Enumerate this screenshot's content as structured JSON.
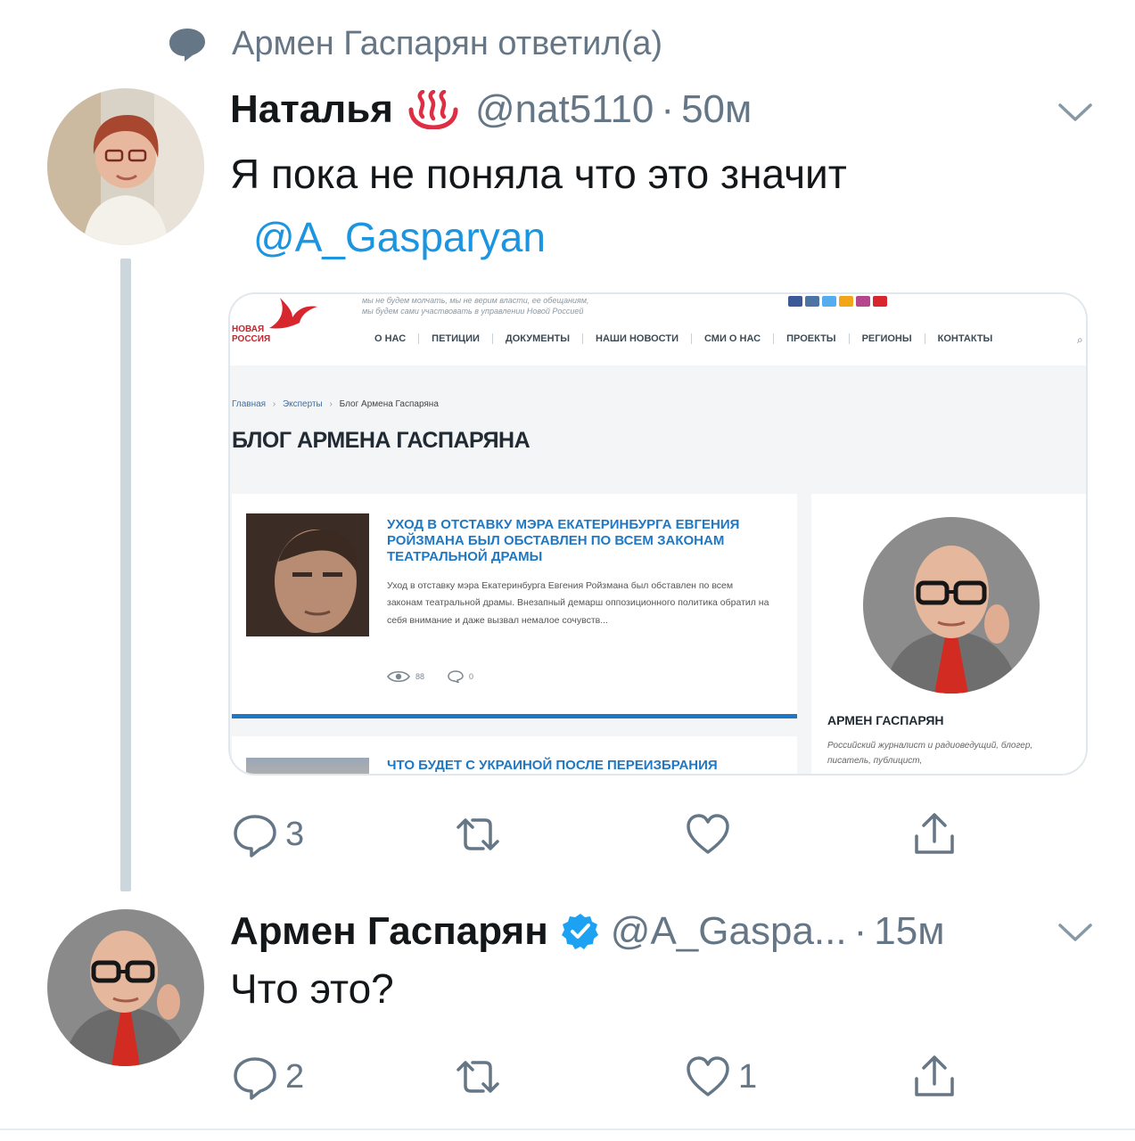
{
  "context": {
    "text": "Армен Гаспарян ответил(а)",
    "icon": "speech-bubble-icon"
  },
  "tweet1": {
    "name": "Наталья",
    "emoji": "hot-springs-emoji",
    "handle": "@nat5110",
    "separator": "·",
    "time": "50м",
    "text": "Я пока не поняла что это значит",
    "mention": "@A_Gasparyan",
    "card": {
      "slogan_line1": "мы не будем молчать, мы не верим власти, ее обещаниям,",
      "slogan_line2": "мы будем сами участвовать в управлении Новой Россией",
      "logo_line1": "НОВАЯ",
      "logo_line2": "РОССИЯ",
      "nav": [
        "О НАС",
        "ПЕТИЦИИ",
        "ДОКУМЕНТЫ",
        "НАШИ НОВОСТИ",
        "СМИ О НАС",
        "ПРОЕКТЫ",
        "РЕГИОНЫ",
        "КОНТАКТЫ"
      ],
      "breadcrumb": {
        "home": "Главная",
        "experts": "Эксперты",
        "current": "Блог Армена Гаспаряна",
        "sep": "›"
      },
      "heading": "БЛОГ АРМЕНА ГАСПАРЯНА",
      "article": {
        "title": "УХОД В ОТСТАВКУ МЭРА ЕКАТЕРИНБУРГА ЕВГЕНИЯ РОЙЗМАНА БЫЛ ОБСТАВЛЕН ПО ВСЕМ ЗАКОНАМ ТЕАТРАЛЬНОЙ ДРАМЫ",
        "excerpt": "Уход в отставку мэра Екатеринбурга Евгения Ройзмана был обставлен по всем законам театральной драмы. Внезапный демарш оппозиционного политика обратил на себя внимание и даже вызвал немалое сочувств...",
        "views": "88",
        "comments": "0"
      },
      "article2_title": "ЧТО БУДЕТ С УКРАИНОЙ ПОСЛЕ ПЕРЕИЗБРАНИЯ",
      "sidebar": {
        "name": "АРМЕН ГАСПАРЯН",
        "bio": "Российский журналист и радиоведущий, блогер, писатель, публицист,"
      }
    },
    "actions": {
      "replies": "3",
      "retweets": "",
      "likes": ""
    }
  },
  "tweet2": {
    "name": "Армен Гаспарян",
    "verified": true,
    "handle": "@A_Gaspa...",
    "separator": "·",
    "time": "15м",
    "text": "Что это?",
    "actions": {
      "replies": "2",
      "retweets": "",
      "likes": "1"
    }
  },
  "colors": {
    "link": "#1b95e0",
    "muted": "#657786",
    "text": "#14171a",
    "thread_line": "#ccd6dd",
    "verified": "#1da1f2",
    "site_blue": "#1f78c4"
  }
}
